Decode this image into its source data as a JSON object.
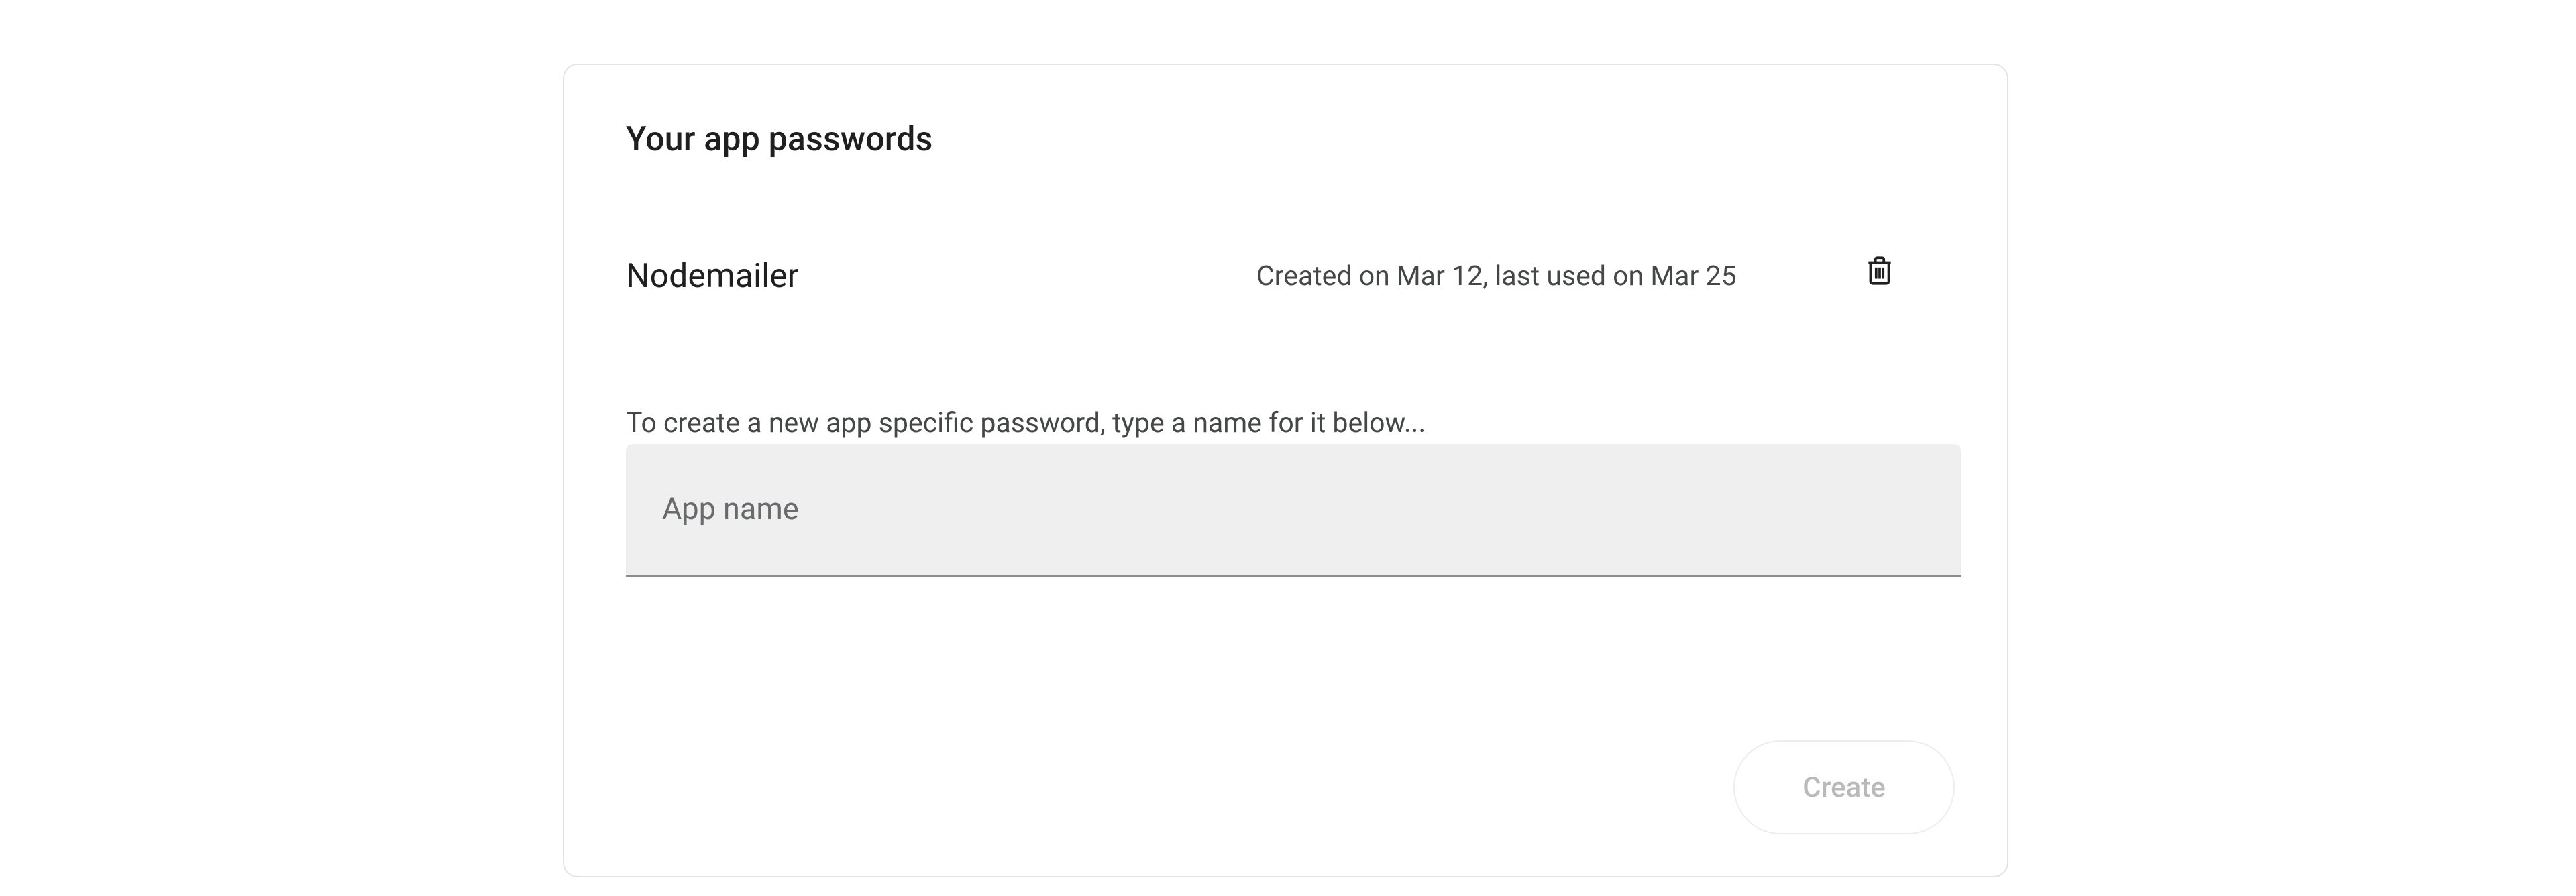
{
  "card": {
    "title": "Your app passwords",
    "passwords": [
      {
        "name": "Nodemailer",
        "meta": "Created on Mar 12, last used on Mar 25"
      }
    ],
    "instruction": "To create a new app specific password, type a name for it below...",
    "input": {
      "label": "App name",
      "value": ""
    },
    "create_label": "Create"
  }
}
